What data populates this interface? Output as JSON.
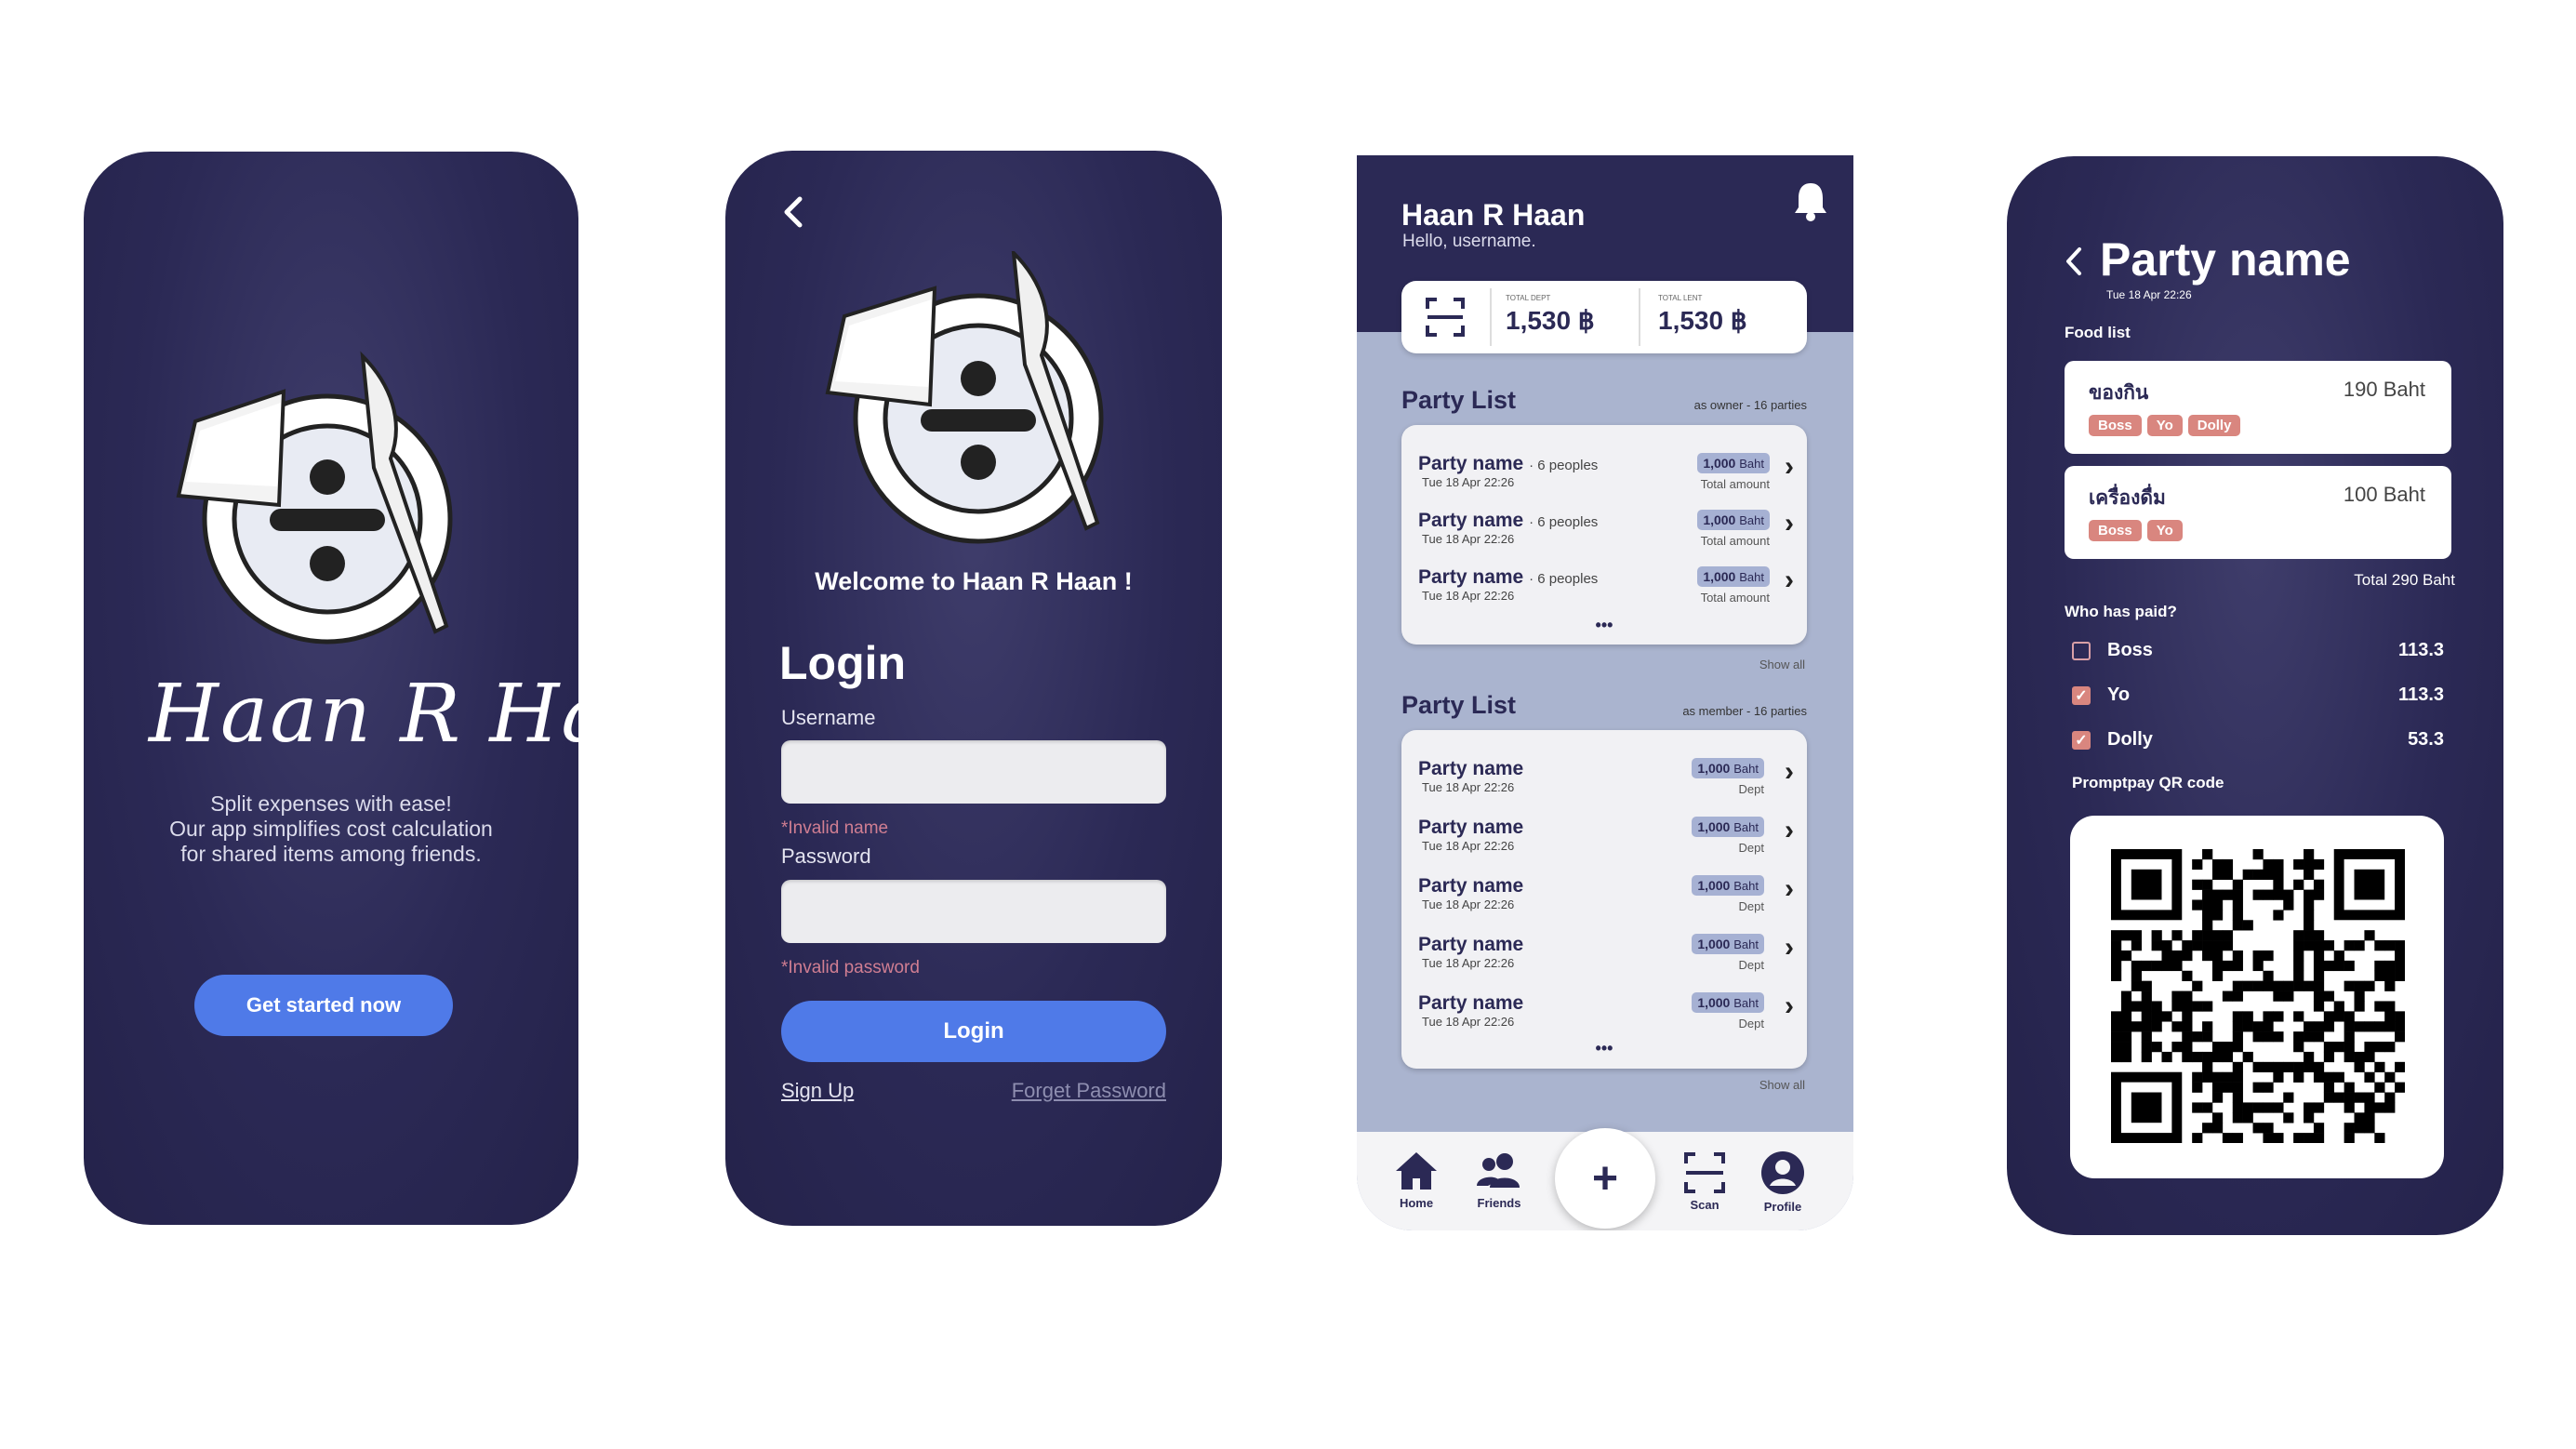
{
  "welcome": {
    "brand_script": "Haan R Haan",
    "tagline": [
      "Split expenses with ease!",
      "Our app simplifies cost calculation",
      "for shared items among friends."
    ],
    "cta_label": "Get started now"
  },
  "login": {
    "welcome_text": "Welcome to Haan R Haan !",
    "title": "Login",
    "username_label": "Username",
    "username_value": "",
    "username_error": "*Invalid name",
    "password_label": "Password",
    "password_value": "",
    "password_error": "*Invalid password",
    "login_button": "Login",
    "signup_link": "Sign Up",
    "forget_link": "Forget Password"
  },
  "home": {
    "app_title": "Haan R Haan",
    "greeting": "Hello, username.",
    "summary": {
      "debt_label": "TOTAL DEPT",
      "debt_value": "1,530 ฿",
      "lent_label": "TOTAL LENT",
      "lent_value": "1,530 ฿"
    },
    "owner_list": {
      "title": "Party List",
      "meta": "as owner - 16 parties",
      "show_all": "Show all",
      "more": "•••",
      "rows": [
        {
          "name": "Party name",
          "people": "· 6 peoples",
          "date": "Tue 18 Apr 22:26",
          "amount": "1,000",
          "unit": "Baht",
          "caption": "Total amount"
        },
        {
          "name": "Party name",
          "people": "· 6 peoples",
          "date": "Tue 18 Apr 22:26",
          "amount": "1,000",
          "unit": "Baht",
          "caption": "Total amount"
        },
        {
          "name": "Party name",
          "people": "· 6 peoples",
          "date": "Tue 18 Apr 22:26",
          "amount": "1,000",
          "unit": "Baht",
          "caption": "Total amount"
        }
      ]
    },
    "member_list": {
      "title": "Party List",
      "meta": "as member - 16 parties",
      "show_all": "Show all",
      "more": "•••",
      "rows": [
        {
          "name": "Party name",
          "date": "Tue 18 Apr 22:26",
          "amount": "1,000",
          "unit": "Baht",
          "caption": "Dept"
        },
        {
          "name": "Party name",
          "date": "Tue 18 Apr 22:26",
          "amount": "1,000",
          "unit": "Baht",
          "caption": "Dept"
        },
        {
          "name": "Party name",
          "date": "Tue 18 Apr 22:26",
          "amount": "1,000",
          "unit": "Baht",
          "caption": "Dept"
        },
        {
          "name": "Party name",
          "date": "Tue 18 Apr 22:26",
          "amount": "1,000",
          "unit": "Baht",
          "caption": "Dept"
        },
        {
          "name": "Party name",
          "date": "Tue 18 Apr 22:26",
          "amount": "1,000",
          "unit": "Baht",
          "caption": "Dept"
        }
      ]
    },
    "nav": {
      "home": "Home",
      "friends": "Friends",
      "add": "+",
      "scan": "Scan",
      "profile": "Profile"
    }
  },
  "party": {
    "title": "Party name",
    "date": "Tue 18 Apr 22:26",
    "food_list_label": "Food list",
    "foods": [
      {
        "name": "ของกิน",
        "price": "190 Baht",
        "tags": [
          "Boss",
          "Yo",
          "Dolly"
        ]
      },
      {
        "name": "เครื่องดื่ม",
        "price": "100 Baht",
        "tags": [
          "Boss",
          "Yo"
        ]
      }
    ],
    "total": "Total 290 Baht",
    "paid_label": "Who has paid?",
    "payers": [
      {
        "name": "Boss",
        "amount": "113.3",
        "paid": false
      },
      {
        "name": "Yo",
        "amount": "113.3",
        "paid": true
      },
      {
        "name": "Dolly",
        "amount": "53.3",
        "paid": true
      }
    ],
    "qr_label": "Promptpay QR code"
  },
  "colors": {
    "navy": "#2b2955",
    "accent": "#4f7ae8",
    "tag": "#d9867f",
    "list_bg": "#aab4cf"
  }
}
